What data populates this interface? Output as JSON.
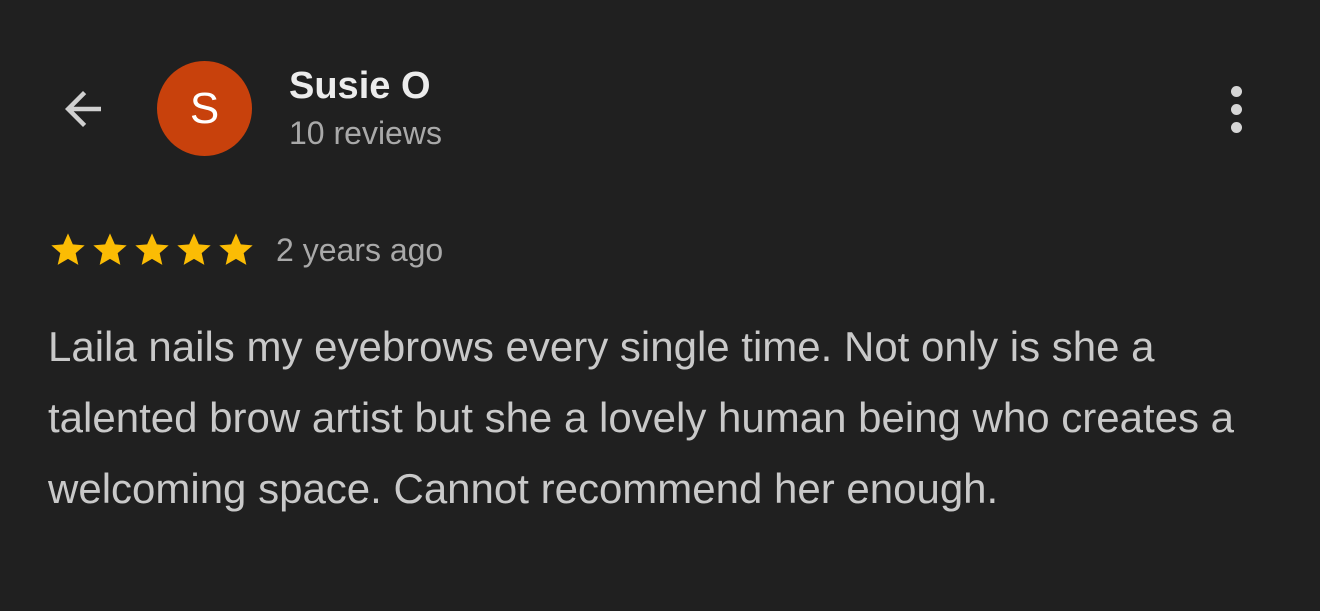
{
  "header": {
    "back_icon": "arrow-left-icon",
    "more_icon": "more-vertical-icon"
  },
  "reviewer": {
    "avatar_initial": "S",
    "avatar_color": "#c8410c",
    "name": "Susie O",
    "review_count": "10 reviews"
  },
  "review": {
    "rating": 5,
    "max_rating": 5,
    "star_color": "#fbbc04",
    "time": "2 years ago",
    "text": "Laila nails my eyebrows every single time. Not only is she a talented brow artist but she a lovely human being who creates a welcoming space. Cannot recommend her enough."
  }
}
